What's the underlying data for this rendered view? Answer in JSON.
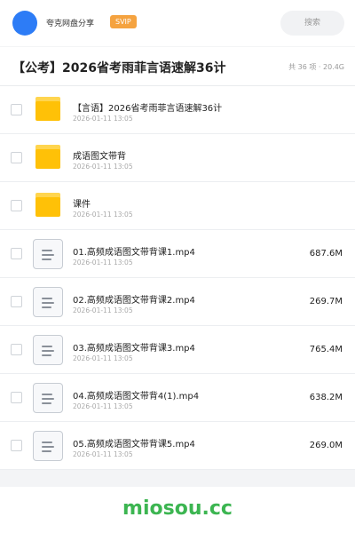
{
  "header": {
    "app_name": "夸克网盘分享",
    "badge": "SVIP",
    "search_placeholder": "搜索",
    "avatar_color": "#2d7cf6",
    "badge_color": "#f5a340"
  },
  "folder": {
    "title": "【公考】2026省考雨菲言语速解36计",
    "meta": "共 36 项 · 20.4G"
  },
  "files": [
    {
      "type": "folder",
      "icon": "folder-icon",
      "name": "【言语】2026省考雨菲言语速解36计",
      "date": "2026-01-11 13:05",
      "size": ""
    },
    {
      "type": "folder",
      "icon": "folder-icon",
      "name": "成语图文带背",
      "date": "2026-01-11 13:05",
      "size": ""
    },
    {
      "type": "folder",
      "icon": "folder-icon",
      "name": "课件",
      "date": "2026-01-11 13:05",
      "size": ""
    },
    {
      "type": "video",
      "icon": "video-file-icon",
      "name": "01.高频成语图文带背课1.mp4",
      "date": "2026-01-11 13:05",
      "size": "687.6M"
    },
    {
      "type": "video",
      "icon": "video-file-icon",
      "name": "02.高频成语图文带背课2.mp4",
      "date": "2026-01-11 13:05",
      "size": "269.7M"
    },
    {
      "type": "video",
      "icon": "video-file-icon",
      "name": "03.高频成语图文带背课3.mp4",
      "date": "2026-01-11 13:05",
      "size": "765.4M"
    },
    {
      "type": "video",
      "icon": "video-file-icon",
      "name": "04.高频成语图文带背4(1).mp4",
      "date": "2026-01-11 13:05",
      "size": "638.2M"
    },
    {
      "type": "video",
      "icon": "video-file-icon",
      "name": "05.高频成语图文带背课5.mp4",
      "date": "2026-01-11 13:05",
      "size": "269.0M"
    }
  ],
  "footer": {
    "watermark": "miosou.cc",
    "watermark_color": "#3cb551"
  }
}
